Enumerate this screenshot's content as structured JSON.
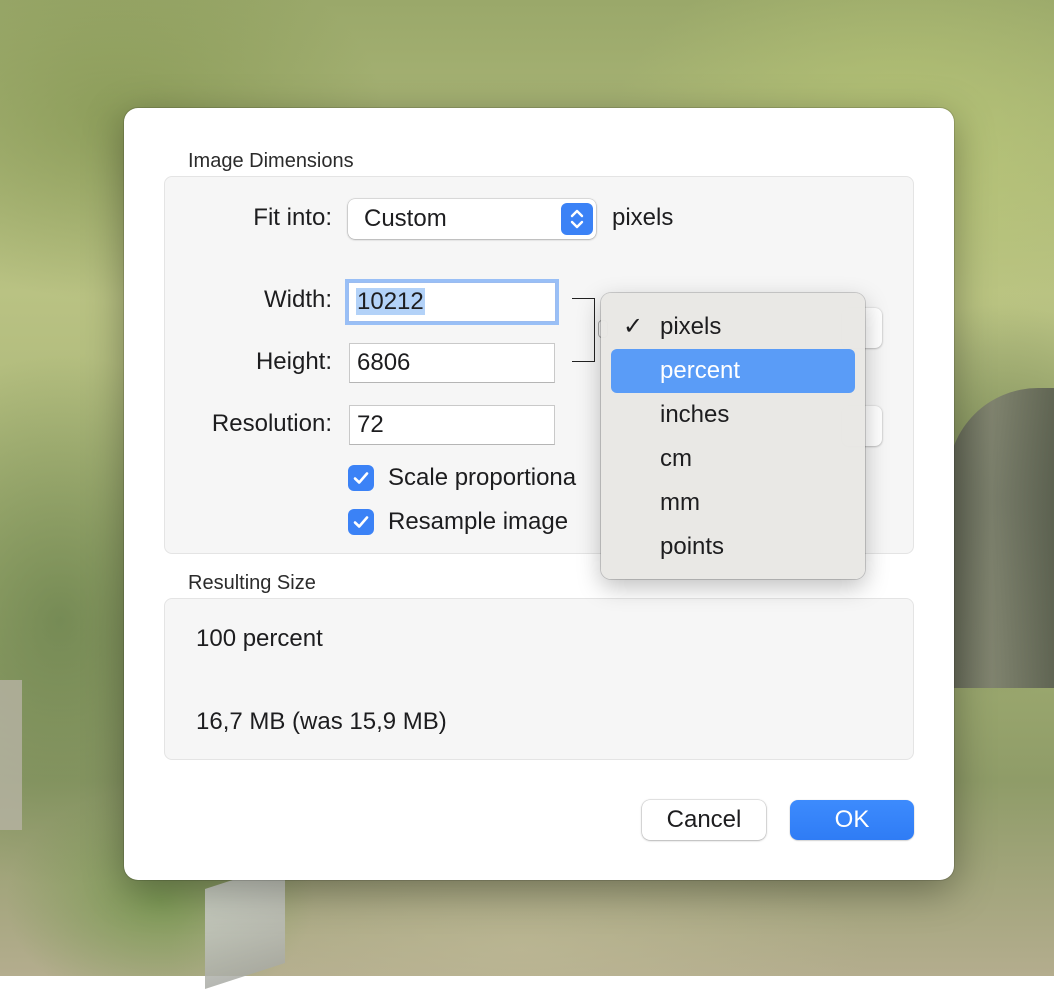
{
  "dialog": {
    "image_dimensions": {
      "title": "Image Dimensions",
      "fit_into": {
        "label": "Fit into:",
        "value": "Custom",
        "units": "pixels"
      },
      "width": {
        "label": "Width:",
        "value": "10212"
      },
      "height": {
        "label": "Height:",
        "value": "6806"
      },
      "resolution": {
        "label": "Resolution:",
        "value": "72"
      },
      "scale_proportionally": {
        "label": "Scale proportiona",
        "checked": true
      },
      "resample_image": {
        "label": "Resample image",
        "checked": true
      }
    },
    "resulting_size": {
      "title": "Resulting Size",
      "percent": "100 percent",
      "size": "16,7 MB (was 15,9 MB)"
    },
    "buttons": {
      "cancel": "Cancel",
      "ok": "OK"
    }
  },
  "units_menu": {
    "check_glyph": "✓",
    "items": [
      "pixels",
      "percent",
      "inches",
      "cm",
      "mm",
      "points"
    ],
    "selected_index": 0,
    "highlighted_index": 1
  },
  "colors": {
    "accent": "#3b82f6",
    "menu_highlight": "#5a9cf7",
    "field_focus": "#4c91f6"
  }
}
